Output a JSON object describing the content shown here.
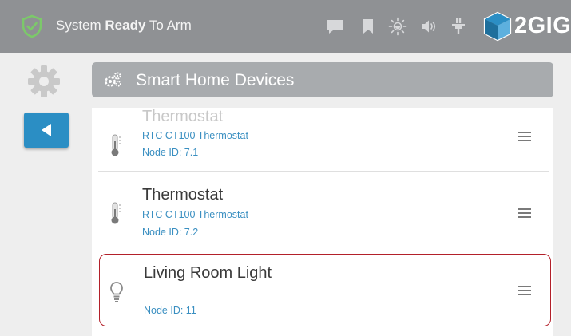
{
  "status_bar": {
    "status_prefix": "System ",
    "status_bold": "Ready",
    "status_suffix": " To Arm",
    "icons": [
      "shield-check-icon",
      "message-icon",
      "bookmark-icon",
      "brightness-icon",
      "volume-icon",
      "power-plug-icon"
    ],
    "brand": "2GIG"
  },
  "sidebar": {
    "icons": [
      "gear-icon",
      "back-arrow-icon"
    ]
  },
  "header": {
    "title": "Smart Home Devices",
    "icon": "smart-home-devices-icon"
  },
  "devices": [
    {
      "name": "Thermostat",
      "model": "RTC CT100 Thermostat",
      "node": "Node ID: 7.1",
      "icon": "thermometer-icon"
    },
    {
      "name": "Thermostat",
      "model": "RTC CT100 Thermostat",
      "node": "Node ID: 7.2",
      "icon": "thermometer-icon"
    },
    {
      "name": "Living Room Light",
      "model": "",
      "node": "Node ID: 11",
      "icon": "lightbulb-icon",
      "selected": true
    }
  ],
  "colors": {
    "topbar": "#8f9194",
    "accent_blue": "#2b8ec4",
    "link_blue": "#3a8fc1",
    "selected_border": "#b3202a",
    "shield_green": "#7cc96a"
  }
}
